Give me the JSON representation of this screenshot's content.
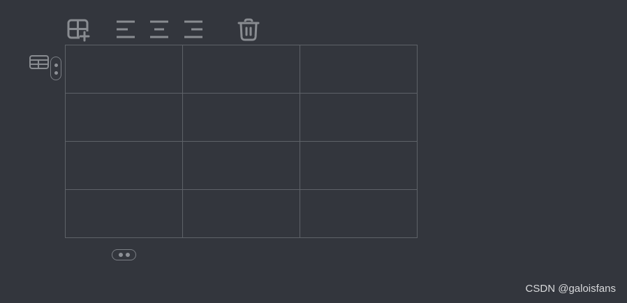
{
  "toolbar": {
    "buttons": [
      {
        "name": "insert-table",
        "icon": "table-plus-icon"
      },
      {
        "name": "align-left",
        "icon": "align-left-icon"
      },
      {
        "name": "align-center",
        "icon": "align-center-icon"
      },
      {
        "name": "align-right",
        "icon": "align-right-icon"
      },
      {
        "name": "delete-table",
        "icon": "trash-icon"
      }
    ]
  },
  "side_icon": "table-icon",
  "table": {
    "rows": [
      [
        "",
        "",
        ""
      ],
      [
        "",
        "",
        ""
      ],
      [
        "",
        "",
        ""
      ],
      [
        "",
        "",
        ""
      ]
    ]
  },
  "handles": {
    "row": "vertical-drag-handle",
    "column": "horizontal-drag-handle"
  },
  "watermark": "CSDN @galoisfans",
  "colors": {
    "background": "#33363d",
    "icon": "#898c91",
    "grid": "#5e6268",
    "text": "#d9dadc"
  }
}
